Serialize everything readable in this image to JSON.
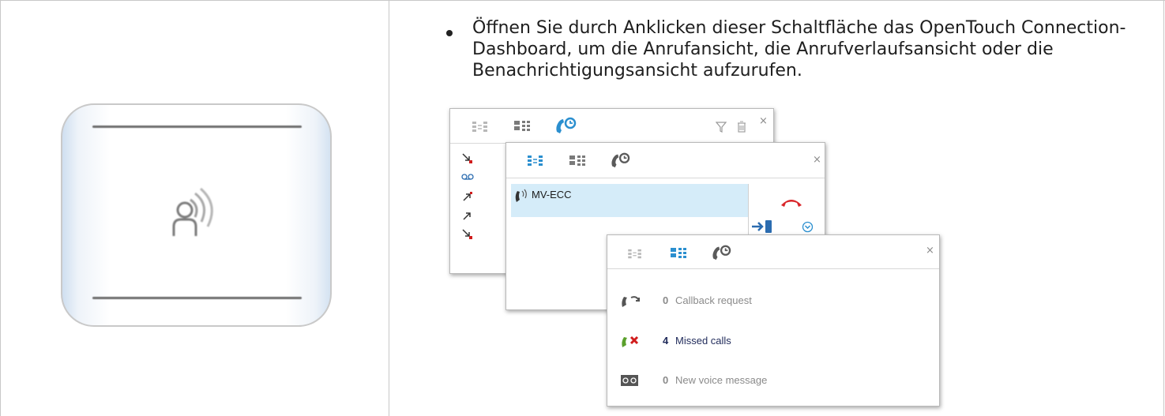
{
  "description": {
    "text": "Öffnen Sie durch Anklicken dieser Schaltfläche das OpenTouch Connection-Dashboard, um die Anrufansicht, die Anrufverlaufsansicht oder die Benachrichtigungsansicht aufzurufen."
  },
  "icon_button": {
    "icon": "person-broadcast-icon"
  },
  "call_window": {
    "active_call": "MV-ECC",
    "close_symbol": "×"
  },
  "history_window": {
    "close_symbol": "×"
  },
  "notification_window": {
    "close_symbol": "×",
    "items": [
      {
        "icon": "callback-icon",
        "count": "0",
        "label": "Callback request",
        "color": "#8a8a8a"
      },
      {
        "icon": "missed-call-icon",
        "count": "4",
        "label": "Missed calls",
        "color": "#1f2a5a"
      },
      {
        "icon": "voicemail-icon",
        "count": "0",
        "label": "New voice message",
        "color": "#8a8a8a"
      }
    ]
  },
  "colors": {
    "accent_blue": "#3aa0d8",
    "hangup_red": "#d9262a",
    "missed_red": "#d01c1c",
    "selected_row": "#d5ecf9"
  }
}
